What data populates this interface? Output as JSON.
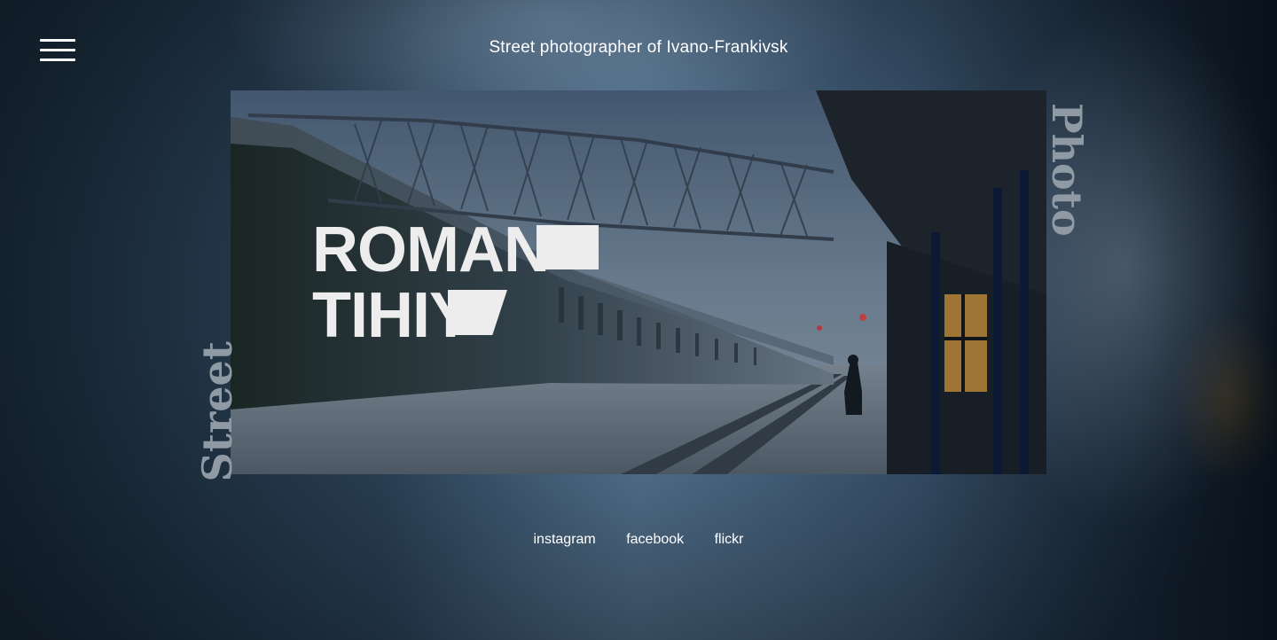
{
  "header": {
    "tagline": "Street photographer of Ivano-Frankivsk"
  },
  "hero": {
    "name_line1": "ROMAN",
    "name_line2": "TIHIY",
    "side_word_right": "Photo",
    "side_word_left": "Street",
    "image_alt": "Snowy railway station platform with train and lone figure"
  },
  "social": {
    "links": [
      {
        "label": "instagram"
      },
      {
        "label": "facebook"
      },
      {
        "label": "flickr"
      }
    ]
  },
  "colors": {
    "accent_text": "#ededed",
    "side_word": "#8f9aa4"
  }
}
